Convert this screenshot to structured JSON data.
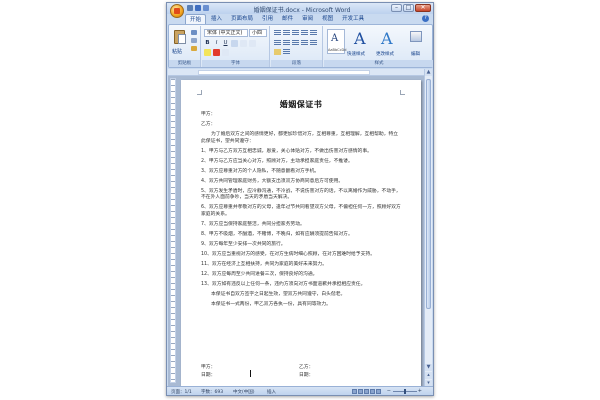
{
  "window": {
    "title": "婚姻保证书.docx - Microsoft Word",
    "minimize": "–",
    "maximize": "□",
    "close": "✕"
  },
  "tabs": [
    "开始",
    "插入",
    "页面布局",
    "引用",
    "邮件",
    "审阅",
    "视图",
    "开发工具"
  ],
  "ribbon": {
    "paste_label": "粘贴",
    "font_name": "宋体 (中文正文)",
    "font_size": "小四",
    "bold": "B",
    "italic": "I",
    "underline": "U",
    "style_caption": "AaBbCcDd",
    "style_sample": "A",
    "quick_styles": "快速样式",
    "change_styles": "更改样式",
    "editing": "编辑",
    "groups": [
      "剪贴板",
      "字体",
      "段落",
      "样式"
    ]
  },
  "document": {
    "title": "婚姻保证书",
    "party_a": "甲方：",
    "party_b": "乙方：",
    "paragraphs": [
      "为了婚后双方之间的感情更好，都更加珍惜对方，互相尊重，互相理解，互相帮助，特立此保证书，望共同遵守：",
      "1、甲方与乙方双方互相忠诚，恩爱，关心体贴对方，不做出伤害对方感情的事。",
      "2、甲方与乙方应当关心对方，照顾对方，主动承担家庭责任，不推诿。",
      "3、双方应尊重对方的个人隐私，不随意翻看对方手机。",
      "4、双方共同管理家庭财务，大额支出须双方协商同意后方可使用。",
      "5、双方发生矛盾时，应冷静沟通，不冷战，不说伤害对方的话，不以离婚作为威胁，不动手，不在外人面前争吵，当天的矛盾当天解决。",
      "6、双方应尊重并孝敬对方的父母，逢年过节共同看望双方父母，不偏袒任何一方，照顾好双方家庭的关系。",
      "7、双方应当保持家庭整洁，共同分担家务劳动。",
      "8、甲方不吸烟，不酗酒，不赌博，不晚归，如有应酬须提前告知对方。",
      "9、双方每年至少安排一次共同的旅行。",
      "10、双方应当重视对方的感受，在对方生病时细心照顾，在对方困难时给予支持。",
      "11、双方在经济上互相扶持，共同为家庭的美好未来努力。",
      "12、双方应每周至少共同进餐三次，保持良好的沟通。",
      "13、双方如有违反以上任何一条，违约方须向对方书面道歉并承担相应责任。",
      "本保证书自双方签字之日起生效，望双方共同遵守，白头偕老。",
      "本保证书一式两份，甲乙双方各执一份，具有同等效力。"
    ],
    "sign_a": "甲方：",
    "sign_b": "乙方：",
    "date_a": "日期：",
    "date_b": "日期："
  },
  "status": {
    "page": "页面：1/1",
    "words": "字数：693",
    "lang": "中文(中国)",
    "insert": "插入",
    "zoom_minus": "−",
    "zoom_plus": "+"
  }
}
